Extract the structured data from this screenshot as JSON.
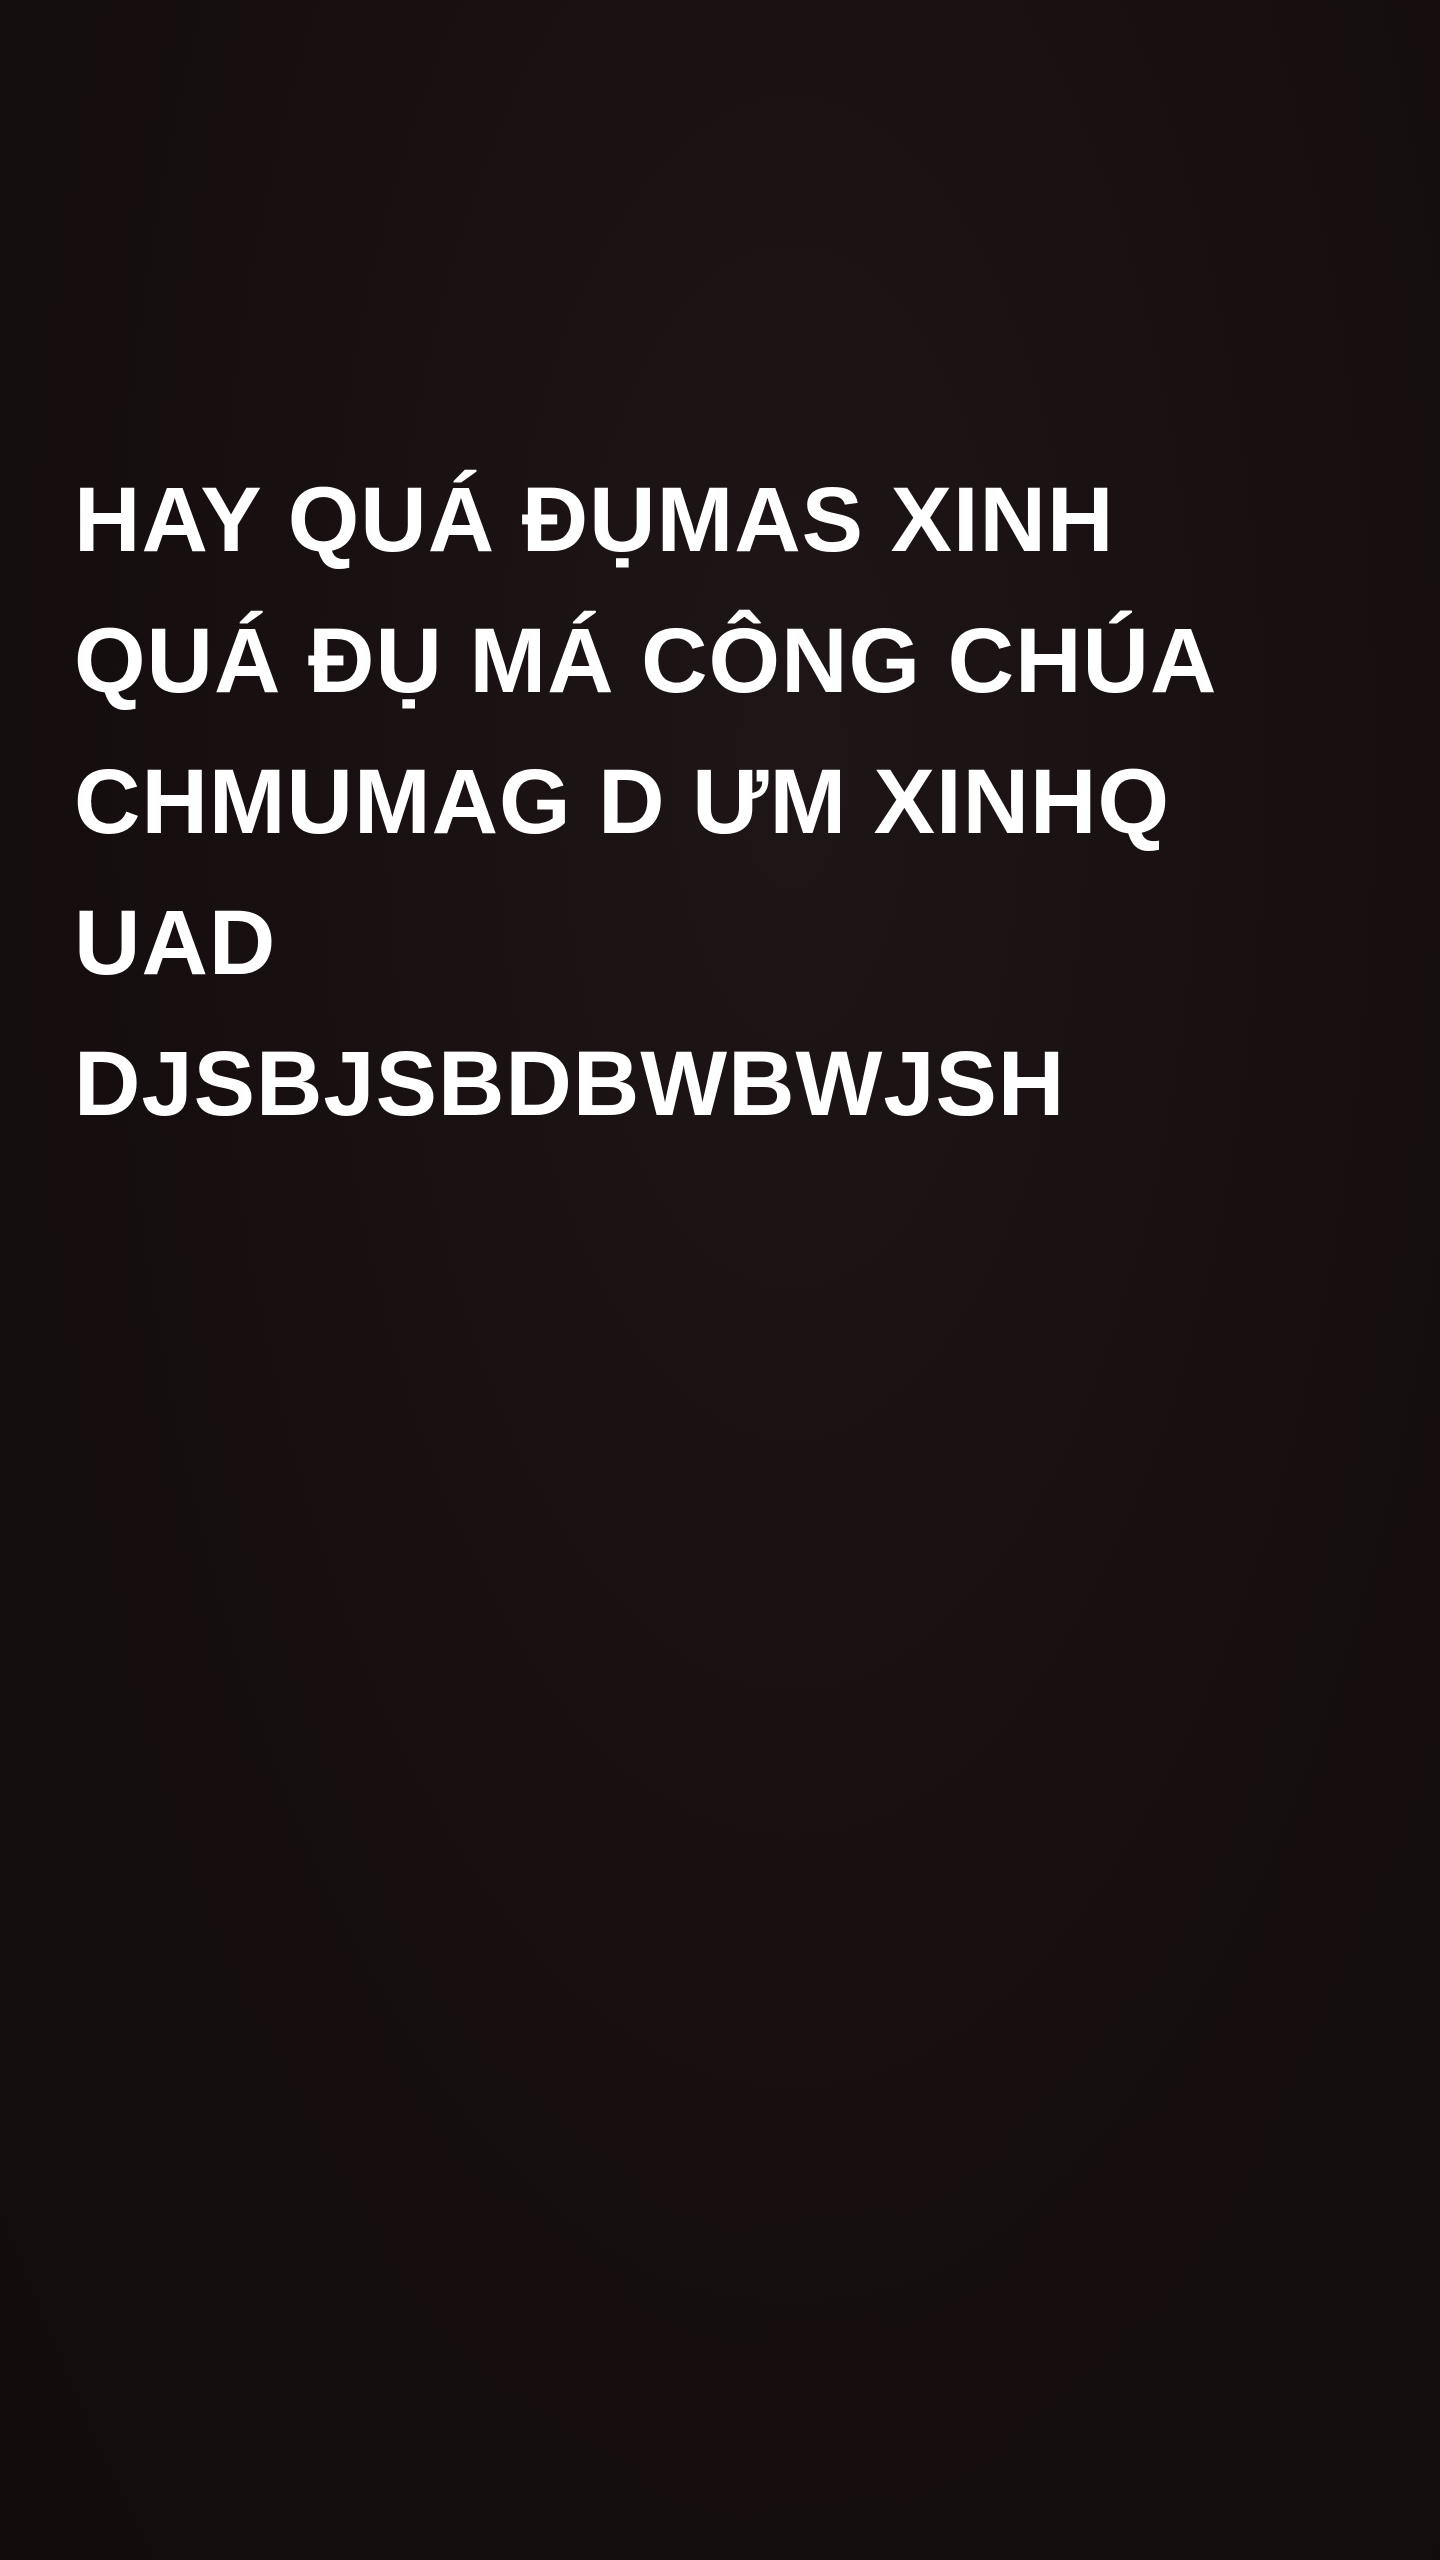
{
  "story": {
    "background_color": "#170f0f",
    "text_color": "#ffffff",
    "lines": [
      "HAY QUÁ ĐỤMAS XINH",
      "QUÁ ĐỤ MÁ CÔNG CHÚA",
      "CHMUMAG D ƯM XINHQ",
      "UAD",
      "DJSBJSBDBWBWJSH"
    ]
  }
}
